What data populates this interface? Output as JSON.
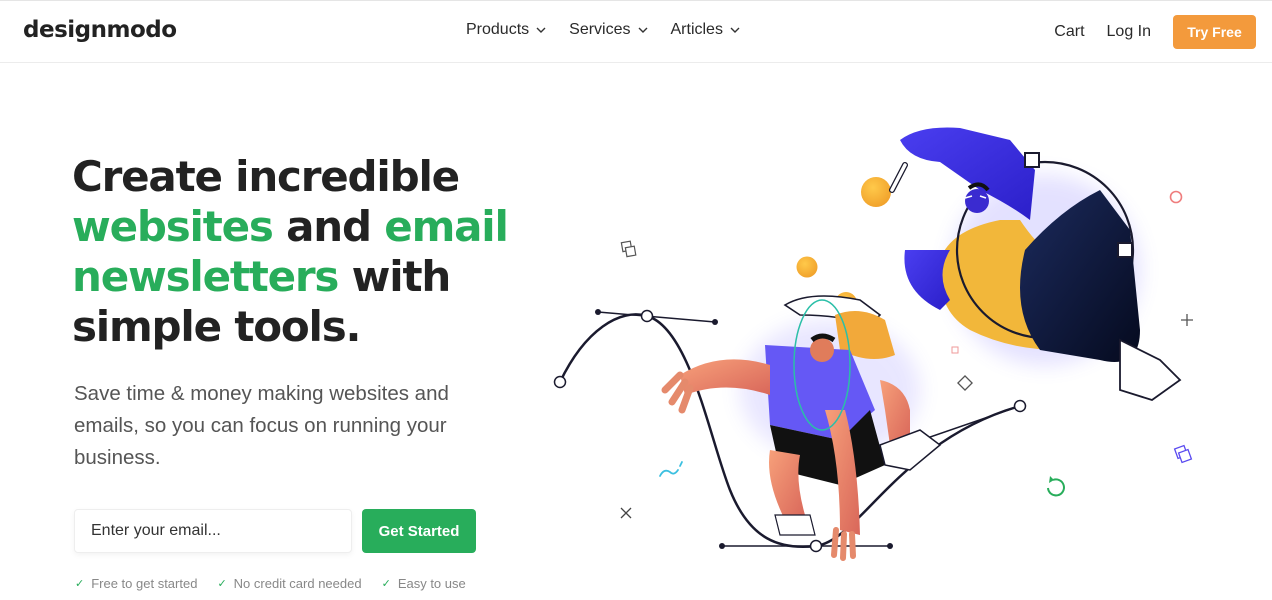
{
  "brand": {
    "logo": "designmodo",
    "accent_green": "#28ad5b",
    "accent_orange": "#f39a3c"
  },
  "nav": {
    "items": [
      {
        "label": "Products"
      },
      {
        "label": "Services"
      },
      {
        "label": "Articles"
      }
    ],
    "cart": "Cart",
    "login": "Log In",
    "try_free": "Try Free"
  },
  "hero": {
    "title_parts": {
      "line1": "Create incredible",
      "hl1": "websites",
      "mid": " and ",
      "hl2": "email",
      "hl3": "newsletters",
      "with": " with",
      "line4": "simple tools."
    },
    "subtitle": "Save time & money making websites and emails, so you can focus on running your business.",
    "email_placeholder": "Enter your email...",
    "cta": "Get Started",
    "perks": [
      "Free to get started",
      "No credit card needed",
      "Easy to use"
    ]
  },
  "illustration": {
    "description": "two-characters-bezier-curves-illustration"
  }
}
